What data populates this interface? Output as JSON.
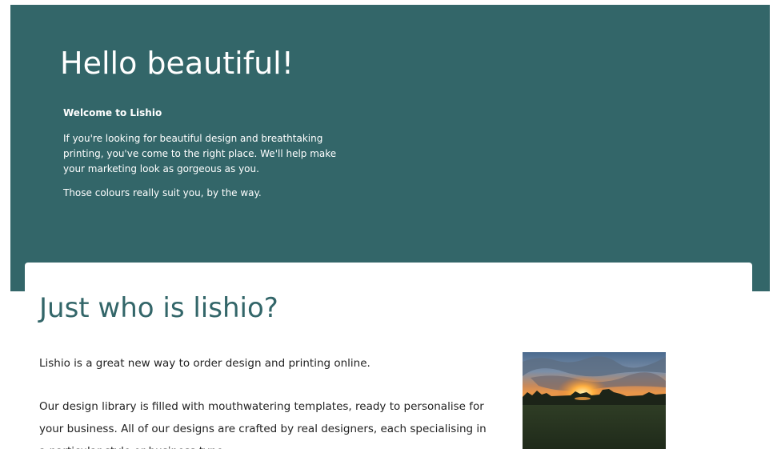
{
  "hero": {
    "title": "Hello beautiful!",
    "subtitle": "Welcome to Lishio",
    "paragraph_1": "If you're looking for beautiful design and breathtaking printing, you've come to the right place. We'll help make your marketing look as gorgeous as you.",
    "paragraph_2": "Those colours really suit you, by the way.",
    "background_color": "#336669"
  },
  "about": {
    "title": "Just who is lishio?",
    "paragraph_1": "Lishio is a great new way to order design and printing online.",
    "paragraph_2": "Our design library is filled with mouthwatering templates, ready to personalise for your business. All of our designs are crafted by real designers, each specialising in a particular style or business type.",
    "title_color": "#336669"
  },
  "photo": {
    "subject": "sunset-over-field"
  }
}
